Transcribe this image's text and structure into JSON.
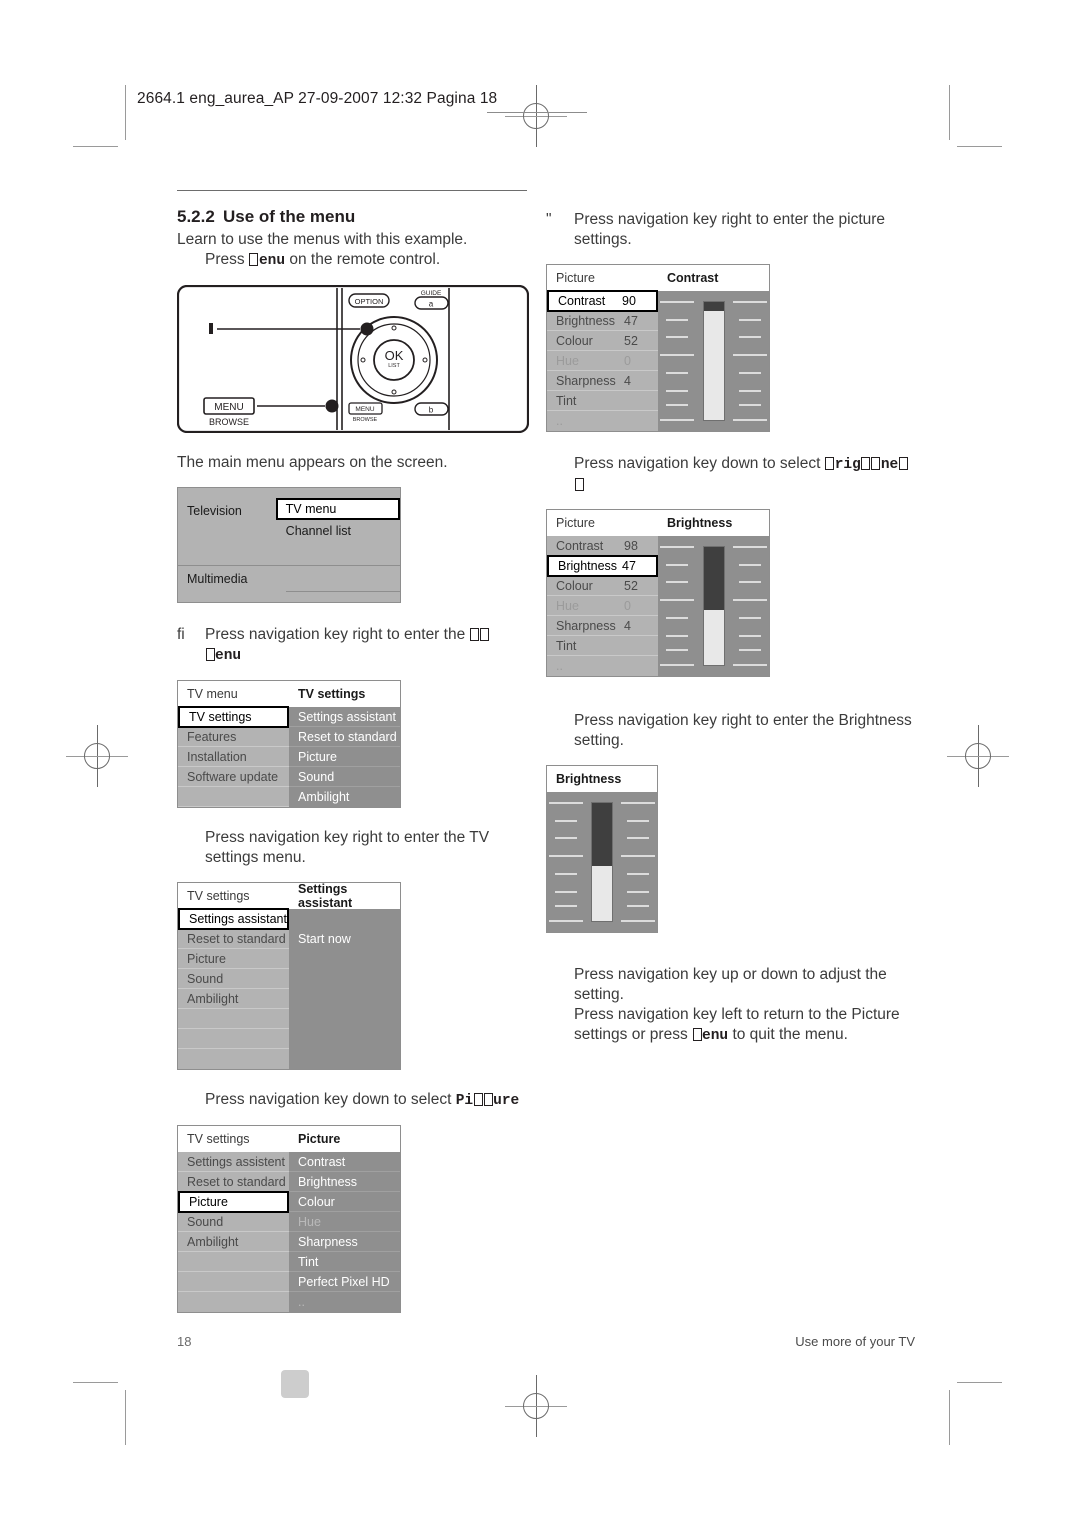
{
  "header": {
    "slug": "2664.1 eng_aurea_AP  27-09-2007  12:32  Pagina 18"
  },
  "section": {
    "number": "5.2.2",
    "title": "Use of the menu",
    "intro": "Learn to use the menus with this example.",
    "step_menu_prefix": "Press ",
    "step_menu_key": "enu",
    "step_menu_suffix": " on the remote control."
  },
  "remote": {
    "option_label": "OPTION",
    "guide_label": "GUIDE",
    "guide_key": "a",
    "ok_label": "OK",
    "ok_sub": "LIST",
    "menu_label": "MENU",
    "browse_label": "BROWSE",
    "menu_small_label": "MENU",
    "browse_small_label": "BROWSE",
    "b_key": "b"
  },
  "left": {
    "main_menu_caption": "The main menu appears on the screen.",
    "main_menu": {
      "rows_left": [
        "Television",
        "",
        "",
        "Multimedia",
        ""
      ],
      "rows_right": [
        "TV menu",
        "Channel list",
        "",
        "",
        ""
      ],
      "selected": "TV menu"
    },
    "step_tvmenu_marker": "fi",
    "step_tvmenu_text": "Press navigation key right to enter the ",
    "step_tvmenu_key": "enu",
    "tv_menu": {
      "head_left": "TV menu",
      "head_right": "TV settings",
      "left_items": [
        "TV settings",
        "Features",
        "Installation",
        "Software update",
        ""
      ],
      "left_selected_index": 0,
      "right_items": [
        "Settings assistant",
        "Reset to standard",
        "Picture",
        "Sound",
        "Ambilight"
      ]
    },
    "caption_tvsettings": "Press navigation key right to enter the TV settings menu.",
    "tv_settings": {
      "head_left": "TV settings",
      "head_right": "Settings assistant",
      "left_items": [
        "Settings assistant",
        "Reset to standard",
        "Picture",
        "Sound",
        "Ambilight",
        "",
        "",
        ""
      ],
      "left_selected_index": 0,
      "right_items": [
        "",
        "Start now",
        "",
        "",
        "",
        "",
        "",
        ""
      ]
    },
    "caption_picture_prefix": "Press navigation key down to select ",
    "caption_picture_key": "Pi",
    "caption_picture_key2": "ure",
    "picture_menu": {
      "head_left": "TV settings",
      "head_right": "Picture",
      "left_items": [
        "Settings assistent",
        "Reset to standard",
        "Picture",
        "Sound",
        "Ambilight",
        "",
        "",
        ""
      ],
      "left_selected_index": 2,
      "right_items": [
        "Contrast",
        "Brightness",
        "Colour",
        "Hue",
        "Sharpness",
        "Tint",
        "Perfect Pixel HD",
        ".."
      ],
      "right_dim_index": 3
    }
  },
  "right": {
    "step_picture_marker": "\"",
    "step_picture_text": "Press navigation key right to enter the picture settings.",
    "contrast_menu": {
      "head_left": "Picture",
      "head_right": "Contrast",
      "items": [
        {
          "name": "Contrast",
          "value": "90"
        },
        {
          "name": "Brightness",
          "value": "47"
        },
        {
          "name": "Colour",
          "value": "52"
        },
        {
          "name": "Hue",
          "value": "0"
        },
        {
          "name": "Sharpness",
          "value": "4"
        },
        {
          "name": "Tint",
          "value": ""
        },
        {
          "name": "..",
          "value": ""
        }
      ],
      "selected_index": 0,
      "dim_index": 3,
      "slider_percent": 92
    },
    "caption_brightness_prefix": "Press navigation key down to select ",
    "caption_brightness_key1": "rig",
    "caption_brightness_key2": "ne",
    "brightness_menu": {
      "head_left": "Picture",
      "head_right": "Brightness",
      "items": [
        {
          "name": "Contrast",
          "value": "98"
        },
        {
          "name": "Brightness",
          "value": "47"
        },
        {
          "name": "Colour",
          "value": "52"
        },
        {
          "name": "Hue",
          "value": "0"
        },
        {
          "name": "Sharpness",
          "value": "4"
        },
        {
          "name": "Tint",
          "value": ""
        },
        {
          "name": "..",
          "value": ""
        }
      ],
      "selected_index": 1,
      "dim_index": 3,
      "slider_percent": 47
    },
    "caption_enter_brightness": "Press navigation key right to enter the Brightness setting.",
    "brightness_panel": {
      "title": "Brightness",
      "slider_percent": 47
    },
    "caption_adjust": "Press navigation key up or down to adjust the setting.",
    "caption_return_prefix": "Press navigation key left to return to the Picture settings or press ",
    "caption_return_key": "enu",
    "caption_return_suffix": " to quit the menu."
  },
  "footer": {
    "page_number": "18",
    "chapter": "Use more of your TV"
  }
}
